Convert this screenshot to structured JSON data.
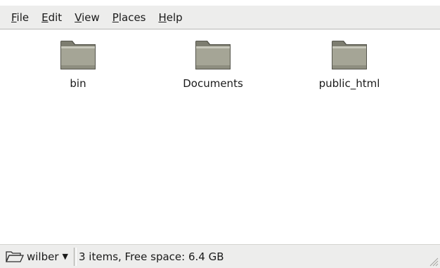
{
  "menubar": {
    "items": [
      {
        "mnemonic": "F",
        "rest": "ile"
      },
      {
        "mnemonic": "E",
        "rest": "dit"
      },
      {
        "mnemonic": "V",
        "rest": "iew"
      },
      {
        "mnemonic": "P",
        "rest": "laces"
      },
      {
        "mnemonic": "H",
        "rest": "elp"
      }
    ]
  },
  "files": [
    {
      "name": "bin",
      "icon": "folder-icon"
    },
    {
      "name": "Documents",
      "icon": "folder-icon"
    },
    {
      "name": "public_html",
      "icon": "folder-icon"
    }
  ],
  "statusbar": {
    "location": "wilber",
    "location_icon": "folder-open-icon",
    "dropdown_icon": "dropdown-arrow-icon",
    "status": "3 items, Free space: 6.4 GB"
  },
  "colors": {
    "chrome_bg": "#ededec",
    "folder_body": "#9b9b8c",
    "content_bg": "#ffffff"
  }
}
